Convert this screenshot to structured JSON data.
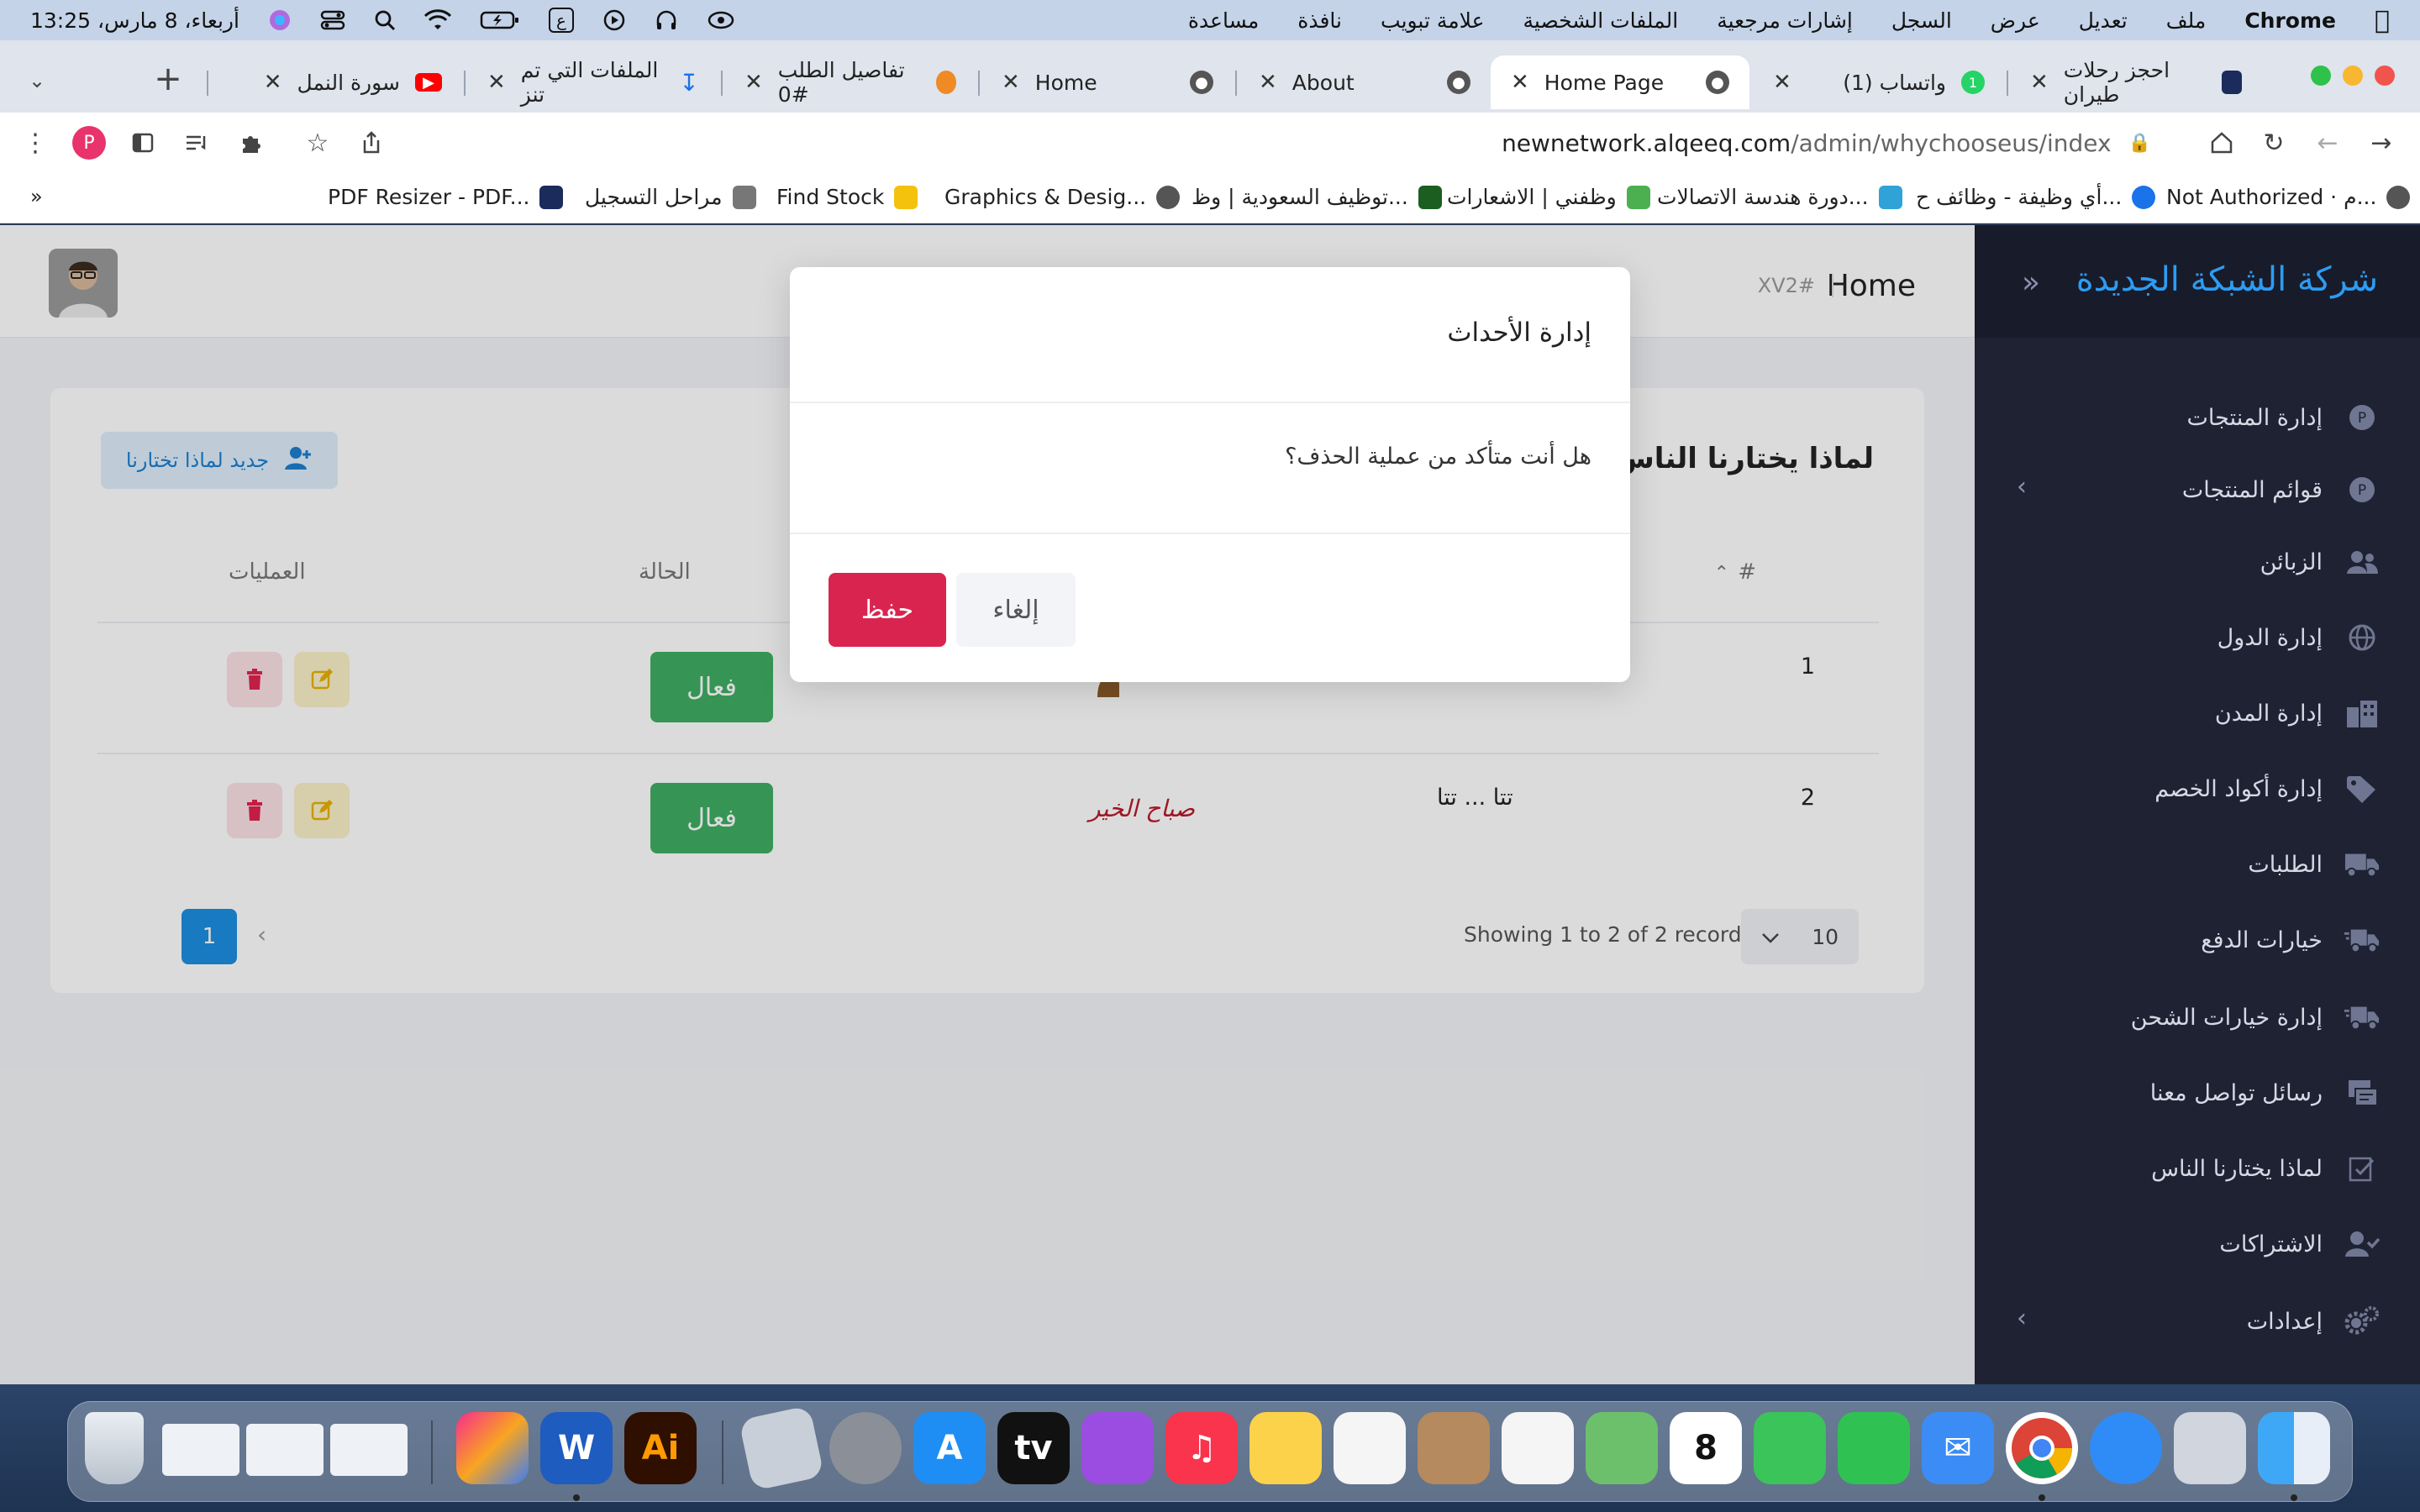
{
  "menubar": {
    "app_name": "Chrome",
    "items": [
      "ملف",
      "تعديل",
      "عرض",
      "السجل",
      "إشارات مرجعية",
      "الملفات الشخصية",
      "علامة تبويب",
      "نافذة",
      "مساعدة"
    ],
    "clock": "أربعاء، 8 مارس، 13:25",
    "input_source": "ع"
  },
  "tabs": [
    {
      "title": "احجز رحلات طيران",
      "icon": "flight-icon",
      "color": "#1a2b5c"
    },
    {
      "title": "(1) واتساب",
      "icon": "whatsapp-icon",
      "color": "#25d366",
      "badge": "1"
    },
    {
      "title": "Home Page",
      "icon": "globe-icon",
      "color": "#555",
      "active": true
    },
    {
      "title": "About",
      "icon": "globe-icon",
      "color": "#555"
    },
    {
      "title": "Home",
      "icon": "globe-icon",
      "color": "#555"
    },
    {
      "title": "تفاصيل الطلب #0",
      "icon": "app-icon",
      "color": "#f08a24"
    },
    {
      "title": "الملفات التي تم تنز",
      "icon": "download-icon",
      "color": "#1a73e8"
    },
    {
      "title": "سورة النمل",
      "icon": "youtube-icon",
      "color": "#ff0000"
    }
  ],
  "omnibox": {
    "domain": "newnetwork.alqeeq.com",
    "path": "/admin/whychooseus/index"
  },
  "bookmarks": [
    {
      "label": "Not Authorized · م...",
      "icon": "globe-icon",
      "color": "#555"
    },
    {
      "label": "أي وظيفة - وظائف ح...",
      "icon": "app-icon",
      "color": "#1a73e8"
    },
    {
      "label": "دورة هندسة الاتصالات...",
      "icon": "app-icon",
      "color": "#2fa3d8"
    },
    {
      "label": "وظفني | الاشعارات",
      "icon": "app-icon",
      "color": "#4caf50"
    },
    {
      "label": "توظيف السعودية | وظ...",
      "icon": "app-icon",
      "color": "#1b5e20"
    },
    {
      "label": "Graphics & Desig...",
      "icon": "globe-icon",
      "color": "#555"
    },
    {
      "label": "Find Stock",
      "icon": "app-icon",
      "color": "#f4c20d"
    },
    {
      "label": "مراحل التسجيل",
      "icon": "app-icon",
      "color": "#555"
    },
    {
      "label": "PDF Resizer - PDF...",
      "icon": "app-icon",
      "color": "#1a2b5c"
    }
  ],
  "sidebar": {
    "brand": "شركة الشبكة الجديدة",
    "items": [
      {
        "label": "إدارة المنتجات",
        "icon": "product-icon"
      },
      {
        "label": "قوائم المنتجات",
        "icon": "product-list-icon",
        "has_children": true
      },
      {
        "label": "الزبائن",
        "icon": "users-icon"
      },
      {
        "label": "إدارة الدول",
        "icon": "globe-icon"
      },
      {
        "label": "إدارة المدن",
        "icon": "city-icon"
      },
      {
        "label": "إدارة أكواد الخصم",
        "icon": "tag-icon"
      },
      {
        "label": "الطلبات",
        "icon": "truck-icon"
      },
      {
        "label": "خيارات الدفع",
        "icon": "truck-fast-icon"
      },
      {
        "label": "إدارة خيارات الشحن",
        "icon": "truck-fast-icon"
      },
      {
        "label": "رسائل تواصل معنا",
        "icon": "contact-icon"
      },
      {
        "label": "لماذا يختارنا الناس",
        "icon": "check-icon"
      },
      {
        "label": "الاشتراكات",
        "icon": "user-check-icon"
      },
      {
        "label": "إعدادات",
        "icon": "gear-icon",
        "has_children": true
      }
    ]
  },
  "header": {
    "title": "Home",
    "subtitle": "XV2#"
  },
  "main": {
    "title": "لماذا يختارنا الناس",
    "new_button": "جديد لماذا تختارنا",
    "columns": {
      "num": "#",
      "status": "الحالة",
      "actions": "العمليات"
    },
    "rows": [
      {
        "num": "1",
        "title": "",
        "status": "فعال"
      },
      {
        "num": "2",
        "title": "تتا ... تتا",
        "status": "فعال",
        "image_text": "صباح الخير"
      }
    ],
    "records": "Showing 1 to 2 of 2 records",
    "per_page": "10",
    "page": "1"
  },
  "modal": {
    "title": "إدارة الأحداث",
    "body": "هل أنت متأكد من عملية الحذف؟",
    "confirm": "حفظ",
    "cancel": "إلغاء"
  }
}
